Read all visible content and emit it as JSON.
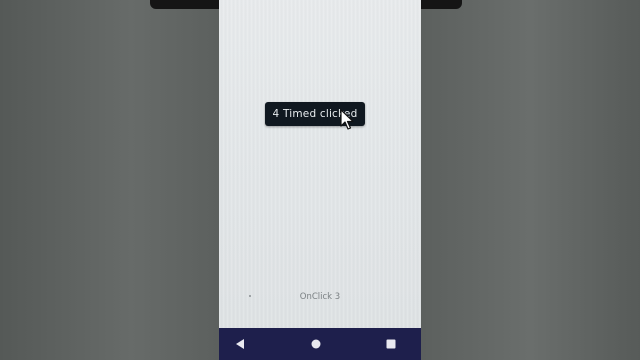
{
  "app": {
    "button_label": "4 Timed clicked",
    "onclick_label": "OnClick 3"
  },
  "icons": {
    "cursor": "mouse-pointer-icon",
    "nav_back": "back-triangle-icon",
    "nav_home": "home-circle-icon",
    "nav_recents": "recents-square-icon"
  },
  "colors": {
    "button_bg": "#101820",
    "button_text": "#e8ecef",
    "nav_bar": "#1e1f4c",
    "screen_bg": "#e4e7e9"
  }
}
